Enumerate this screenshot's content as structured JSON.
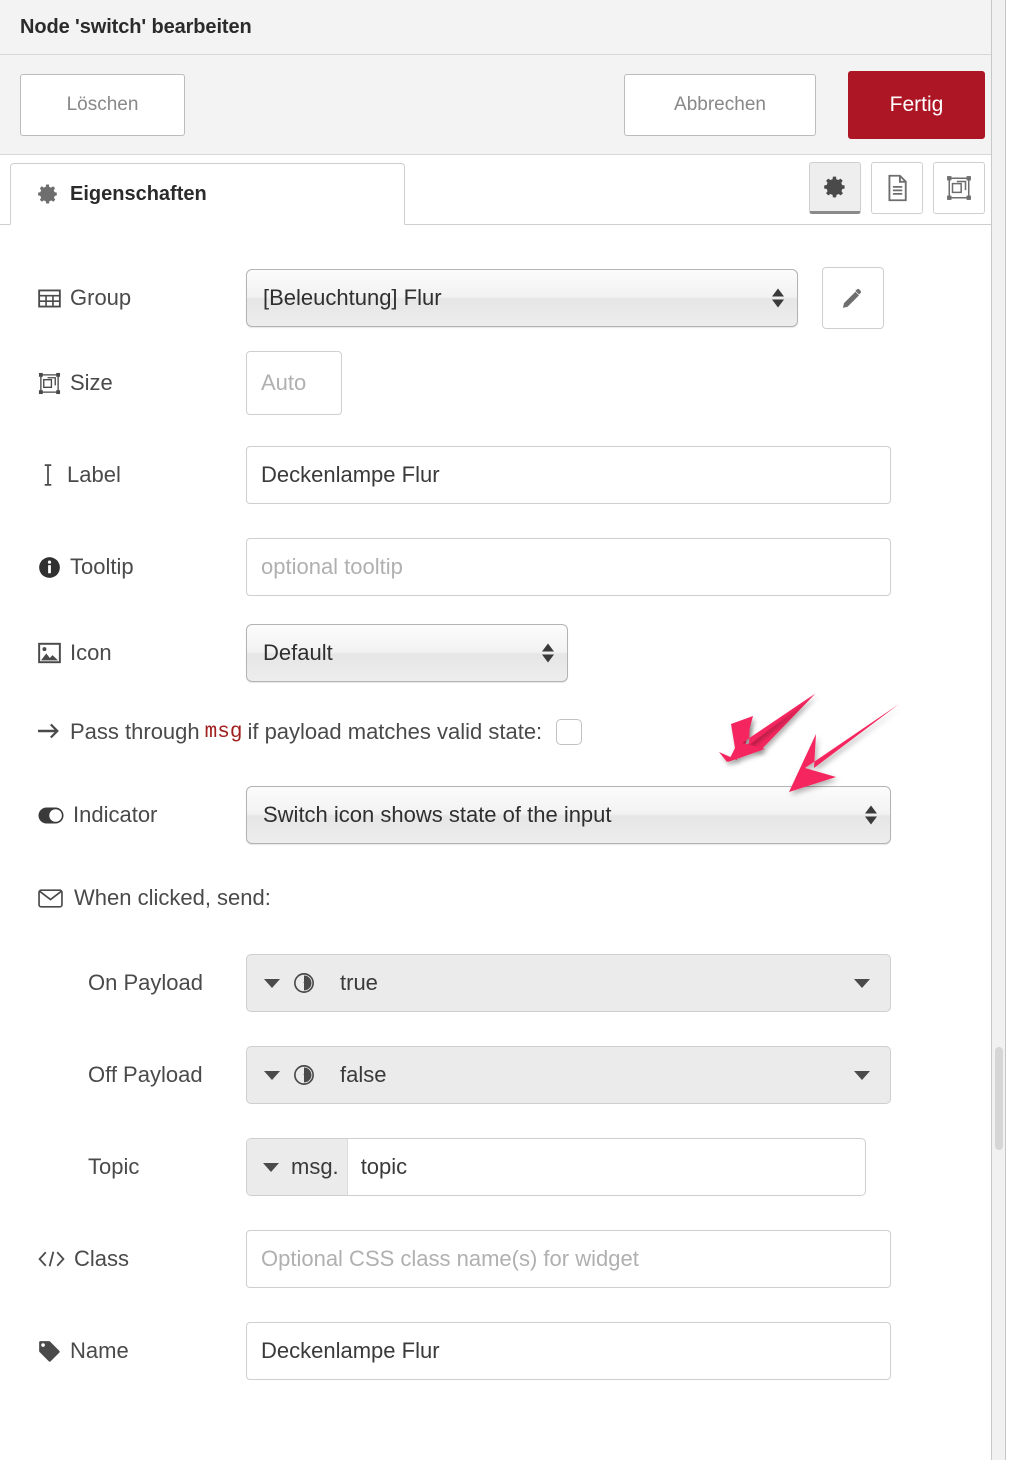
{
  "window": {
    "title": "Node 'switch' bearbeiten"
  },
  "toolbar": {
    "delete_label": "Löschen",
    "cancel_label": "Abbrechen",
    "done_label": "Fertig",
    "done_color": "#ad1625"
  },
  "tabs": {
    "active_tab_label": "Eigenschaften",
    "icon_buttons": [
      {
        "name": "properties",
        "icon": "gear-icon",
        "active": true
      },
      {
        "name": "description",
        "icon": "document-icon",
        "active": false
      },
      {
        "name": "appearance",
        "icon": "appearance-icon",
        "active": false
      }
    ]
  },
  "form": {
    "group": {
      "label": "Group",
      "icon": "table-icon",
      "value": "[Beleuchtung] Flur",
      "edit_button_icon": "pencil-icon"
    },
    "size": {
      "label": "Size",
      "icon": "resize-icon",
      "value": "Auto"
    },
    "label_field": {
      "label": "Label",
      "icon": "text-cursor-icon",
      "value": "Deckenlampe Flur"
    },
    "tooltip": {
      "label": "Tooltip",
      "icon": "info-circle-icon",
      "value": "",
      "placeholder": "optional tooltip"
    },
    "icon_field": {
      "label": "Icon",
      "icon": "image-icon",
      "value": "Default"
    },
    "pass_through": {
      "icon": "arrow-right-icon",
      "text_before": "Pass through",
      "token": "msg",
      "text_after": "if payload matches valid state:",
      "checked": false
    },
    "indicator": {
      "label": "Indicator",
      "icon": "toggle-switch-icon",
      "value": "Switch icon shows state of the input"
    },
    "when_clicked": {
      "icon": "envelope-icon",
      "label": "When clicked, send:"
    },
    "on_payload": {
      "label": "On Payload",
      "type_icon": "boolean-toggle-icon",
      "value": "true"
    },
    "off_payload": {
      "label": "Off Payload",
      "type_icon": "boolean-toggle-icon",
      "value": "false"
    },
    "topic": {
      "label": "Topic",
      "prefix": "msg.",
      "value": "topic"
    },
    "class_field": {
      "label": "Class",
      "icon": "code-icon",
      "value": "",
      "placeholder": "Optional CSS class name(s) for widget"
    },
    "name_field": {
      "label": "Name",
      "icon": "tag-icon",
      "value": "Deckenlampe Flur"
    }
  },
  "annotations": {
    "arrow_color": "#f5255e",
    "arrows": [
      {
        "name": "arrow-to-checkbox"
      },
      {
        "name": "arrow-to-indicator"
      }
    ]
  }
}
